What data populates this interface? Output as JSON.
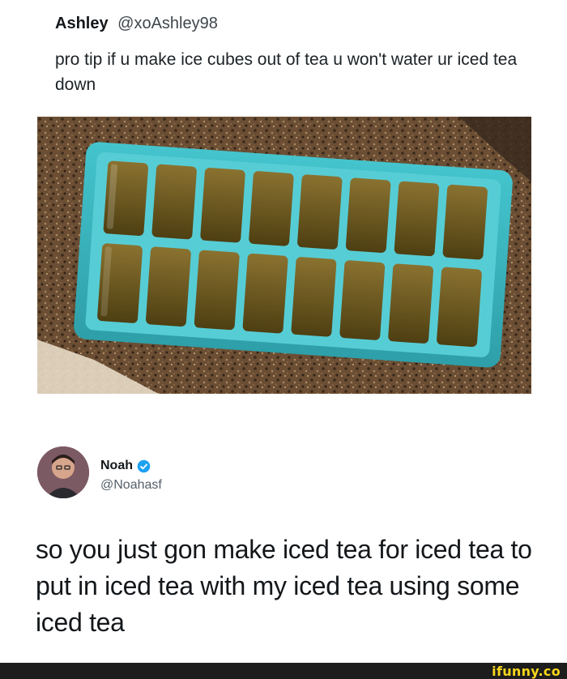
{
  "tweet1": {
    "name": "Ashley",
    "handle": "@xoAshley98",
    "text": "pro tip if u make ice cubes out of tea u won't water ur iced tea down",
    "photo_icon": "ice-cube-tray-photo"
  },
  "tweet2": {
    "name": "Noah",
    "handle": "@Noahasf",
    "verified_icon": "verified-badge-icon",
    "text": "so you just gon make iced tea for iced tea to put in iced tea with my iced tea using some iced tea"
  },
  "footer": {
    "watermark": "ifunny.co"
  },
  "colors": {
    "tray": "#3ab8c2",
    "tea": "#6b5a1e",
    "counter": "#6b4e33",
    "verified": "#1da1f2",
    "watermark": "#f8d61b"
  }
}
